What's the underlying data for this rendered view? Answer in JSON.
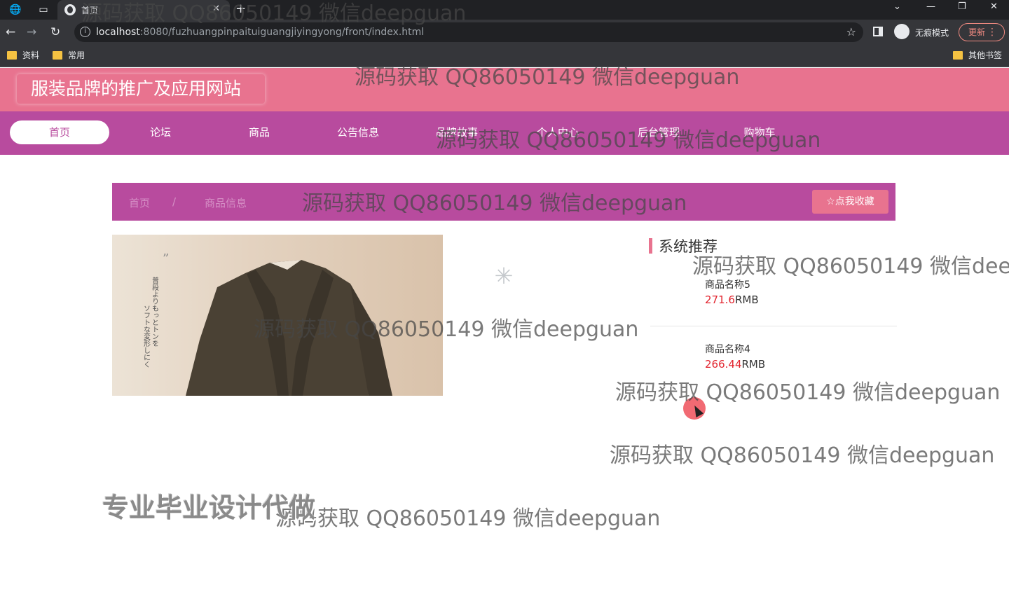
{
  "browser": {
    "tab_title": "首页",
    "tab_close": "✕",
    "new_tab": "+",
    "url_host": "localhost",
    "url_path": ":8080/fuzhuangpinpaituiguangjiyingyong/front/index.html",
    "incognito_label": "无痕模式",
    "update_label": "更新",
    "bookmarks": [
      "资料",
      "常用"
    ],
    "other_bookmarks": "其他书签"
  },
  "site": {
    "title": "服装品牌的推广及应用网站",
    "nav": [
      {
        "label": "首页",
        "active": true
      },
      {
        "label": "论坛"
      },
      {
        "label": "商品"
      },
      {
        "label": "公告信息"
      },
      {
        "label": "品牌故事"
      },
      {
        "label": "个人中心"
      },
      {
        "label": "后台管理"
      },
      {
        "label": "购物车"
      }
    ],
    "breadcrumb": {
      "home": "首页",
      "separator": "/",
      "current": "商品信息"
    },
    "favorite_button": "☆点我收藏",
    "recommend": {
      "title": "系统推荐",
      "items": [
        {
          "name": "商品名称5",
          "price": "271.6",
          "unit": "RMB"
        },
        {
          "name": "商品名称4",
          "price": "266.44",
          "unit": "RMB"
        }
      ]
    },
    "colors": {
      "header": "#e8738f",
      "nav": "#b84b9e",
      "price": "#e2242e"
    }
  },
  "watermarks": {
    "text": "源码获取 QQ86050149 微信deepguan",
    "text_clipped": "源码获取 QQ86050149 微信deep",
    "bold_text": "专业毕业设计代做"
  }
}
